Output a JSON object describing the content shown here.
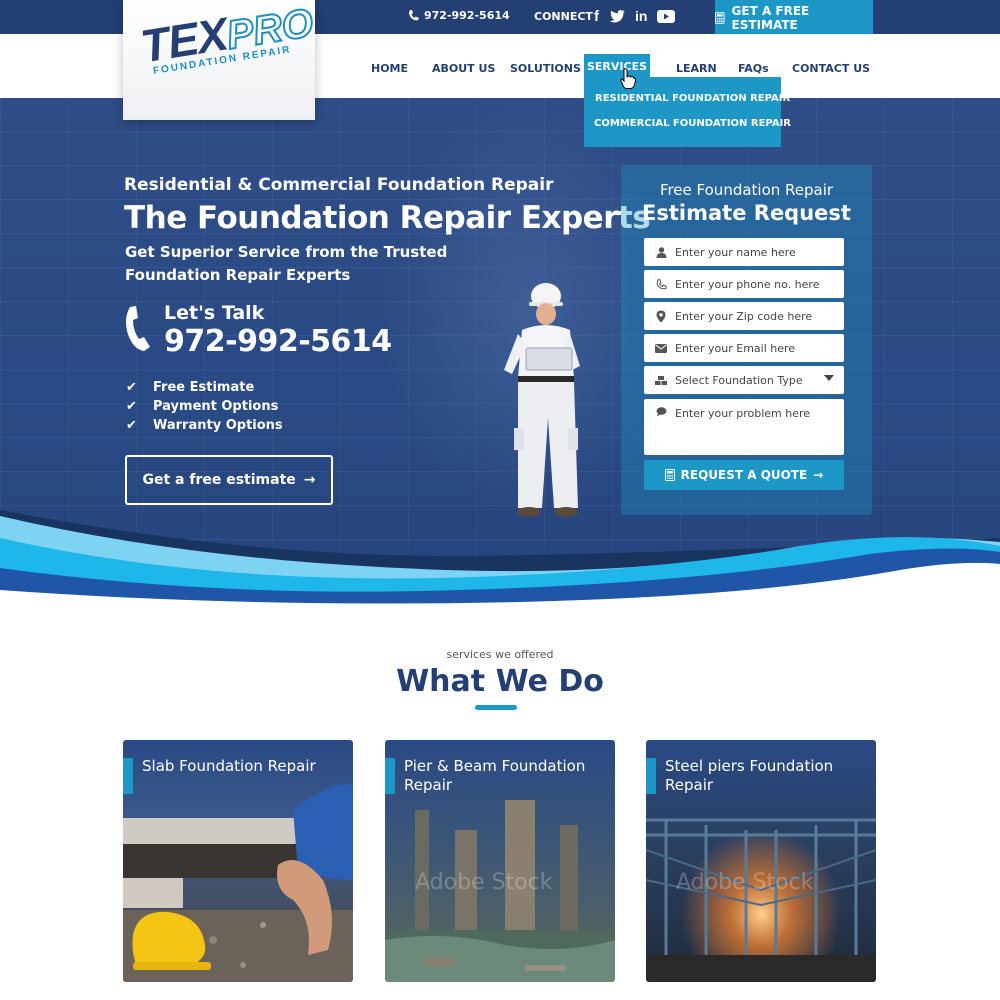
{
  "topbar": {
    "phone": "972-992-5614",
    "connect_label": "CONNECT",
    "socials": [
      "f",
      "twitter",
      "in",
      "youtube"
    ],
    "estimate_label": "GET A FREE ESTIMATE"
  },
  "logo": {
    "tex": "TEX",
    "pro": "PRO",
    "sub": "FOUNDATION REPAIR"
  },
  "nav": {
    "items": [
      "HOME",
      "ABOUT US",
      "SOLUTIONS",
      "SERVICES",
      "LEARN",
      "FAQs",
      "CONTACT US"
    ],
    "dropdown": [
      "RESIDENTIAL FOUNDATION REPAIR",
      "COMMERCIAL  FOUNDATION REPAIR"
    ]
  },
  "hero": {
    "kicker": "Residential & Commercial Foundation Repair",
    "title": "The Foundation Repair Experts",
    "subtitle": "Get Superior Service from the Trusted Foundation Repair Experts",
    "lets_talk": "Let's Talk",
    "phone": "972-992-5614",
    "checks": [
      "Free Estimate",
      "Payment Options",
      "Warranty Options"
    ],
    "cta": "Get a free estimate"
  },
  "form": {
    "title_line1": "Free Foundation Repair",
    "title_line2": "Estimate Request",
    "name_placeholder": "Enter your name here",
    "phone_placeholder": "Enter your phone no. here",
    "zip_placeholder": "Enter your Zip code here",
    "email_placeholder": "Enter your Email here",
    "type_select": "Select Foundation Type",
    "problem_placeholder": "Enter your problem here",
    "submit": "REQUEST A QUOTE"
  },
  "services": {
    "kicker": "services we offered",
    "title": "What We Do",
    "cards": [
      {
        "title": "Slab Foundation Repair"
      },
      {
        "title": "Pier & Beam Foundation Repair",
        "watermark": "Adobe Stock"
      },
      {
        "title": "Steel piers Foundation Repair",
        "watermark": "Adobe Stock"
      }
    ]
  },
  "colors": {
    "navy": "#233f73",
    "accent": "#1c97c6",
    "hero": "#2c4a84"
  }
}
